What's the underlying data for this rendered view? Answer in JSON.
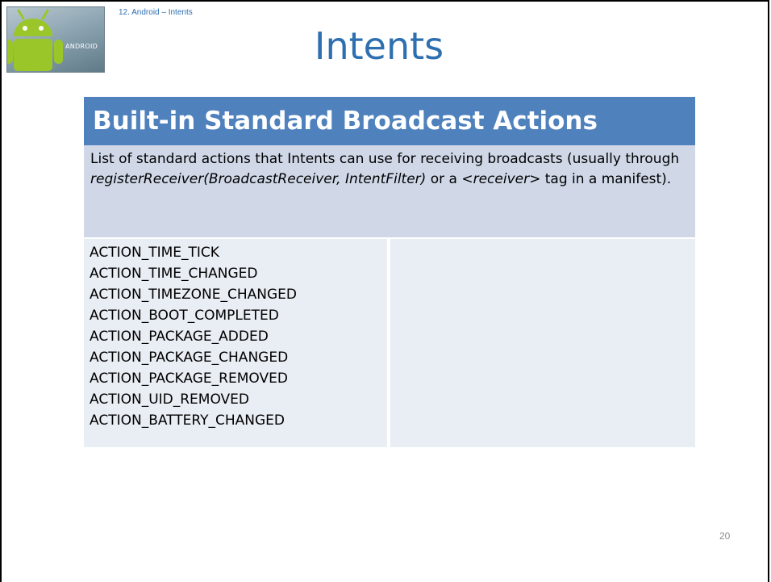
{
  "breadcrumb": "12. Android – Intents",
  "title": "Intents",
  "logo_text": "ANDROID",
  "section_header": "Built-in Standard Broadcast Actions",
  "description": {
    "part1": "List of standard actions that Intents can use for receiving broadcasts (usually through ",
    "italic1": "registerReceiver(BroadcastReceiver, IntentFilter)",
    "part2": " or a ",
    "italic2": "<receiver>",
    "part3": " tag in a manifest)."
  },
  "actions": [
    "ACTION_TIME_TICK",
    "ACTION_TIME_CHANGED",
    "ACTION_TIMEZONE_CHANGED",
    "ACTION_BOOT_COMPLETED",
    "ACTION_PACKAGE_ADDED",
    "ACTION_PACKAGE_CHANGED",
    "ACTION_PACKAGE_REMOVED",
    "ACTION_UID_REMOVED",
    "ACTION_BATTERY_CHANGED"
  ],
  "page_number": "20",
  "colors": {
    "title": "#2e6fb0",
    "header_bar": "#4f81bd",
    "description_bg": "#d0d8e8",
    "list_bg": "#e9edf4"
  }
}
